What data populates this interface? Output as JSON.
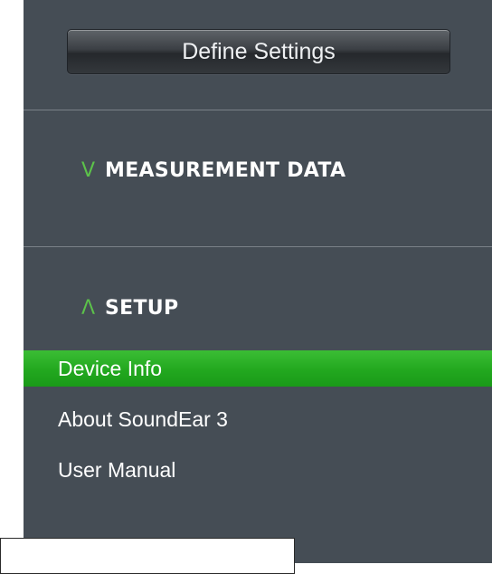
{
  "toolbar": {
    "define_label": "Define Settings"
  },
  "sections": [
    {
      "chevron": "V",
      "icon": "chevron-down-icon",
      "label": "MEASUREMENT DATA"
    },
    {
      "chevron": "Λ",
      "icon": "chevron-up-icon",
      "label": "SETUP"
    }
  ],
  "setup_items": [
    {
      "label": "Device Info",
      "active": true
    },
    {
      "label": "About SoundEar 3",
      "active": false
    },
    {
      "label": "User Manual",
      "active": false
    }
  ],
  "colors": {
    "panel_bg": "#454d55",
    "accent_green": "#5cc24a",
    "active_item": "#22a81f",
    "text": "#ffffff"
  }
}
